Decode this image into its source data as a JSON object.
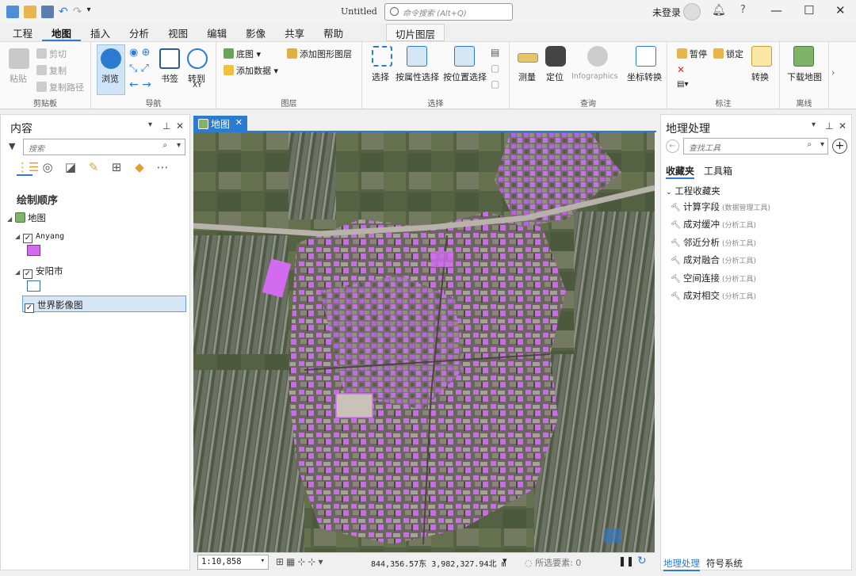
{
  "window": {
    "title": "Untitled",
    "command_search_placeholder": "命令搜索 (Alt+Q)",
    "login": "未登录"
  },
  "tabs": [
    "工程",
    "地图",
    "插入",
    "分析",
    "视图",
    "编辑",
    "影像",
    "共享",
    "帮助"
  ],
  "context_tab": "切片图层",
  "ribbon": {
    "clipboard": {
      "paste": "粘贴",
      "cut": "剪切",
      "copy": "复制",
      "copy_path": "复制路径",
      "label": "剪贴板"
    },
    "navigate": {
      "explore": "浏览",
      "bookmarks": "书签",
      "goto_xy": "转到",
      "xy": "XY",
      "label": "导航"
    },
    "layer": {
      "basemap": "底图",
      "add_data": "添加数据",
      "add_graphics": "添加图形图层",
      "label": "图层"
    },
    "selection": {
      "select": "选择",
      "by_attr": "按属性选择",
      "by_loc": "按位置选择",
      "label": "选择"
    },
    "inquiry": {
      "measure": "测量",
      "locate": "定位",
      "infographics": "Infographics",
      "convert_coords": "坐标转换",
      "label": "查询"
    },
    "labeling": {
      "pause": "暂停",
      "lock": "锁定",
      "convert": "转换",
      "label": "标注"
    },
    "offline": {
      "download": "下载地图",
      "label": "离线"
    }
  },
  "contents": {
    "title": "内容",
    "search_placeholder": "搜索",
    "draw_order": "绘制顺序",
    "layers": [
      {
        "name": "地图",
        "type": "map"
      },
      {
        "name": "Anyang",
        "checked": true,
        "swatch": "#d36bf0"
      },
      {
        "name": "安阳市",
        "checked": true,
        "swatch": "#ffffff"
      },
      {
        "name": "世界影像图",
        "checked": true,
        "selected": true
      }
    ]
  },
  "map_view": {
    "tab_label": "地图",
    "scale": "1:10,858",
    "coordinates": "844,356.57东 3,982,327.94北 m",
    "selected_features": "所选要素: 0"
  },
  "geoprocessing": {
    "title": "地理处理",
    "search_placeholder": "查找工具",
    "tabs": [
      "收藏夹",
      "工具箱"
    ],
    "section": "工程收藏夹",
    "tools": [
      {
        "name": "计算字段",
        "box": "(数据管理工具)"
      },
      {
        "name": "成对缓冲",
        "box": "(分析工具)"
      },
      {
        "name": "邻近分析",
        "box": "(分析工具)"
      },
      {
        "name": "成对融合",
        "box": "(分析工具)"
      },
      {
        "name": "空间连接",
        "box": "(分析工具)"
      },
      {
        "name": "成对相交",
        "box": "(分析工具)"
      }
    ],
    "bottom_tabs": [
      "地理处理",
      "符号系统"
    ]
  },
  "colors": {
    "accent": "#2b7bd0",
    "building": "#d36bf0"
  }
}
